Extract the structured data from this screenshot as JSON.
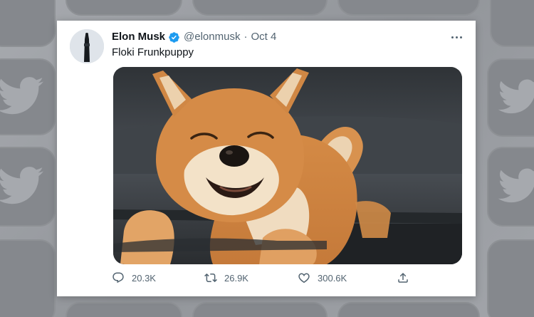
{
  "background": {
    "pattern_icon": "twitter-bird-icon"
  },
  "tweet": {
    "author": {
      "name": "Elon Musk",
      "handle": "@elonmusk",
      "verified_icon": "verified-badge-icon",
      "verified_color": "#1d9bf0"
    },
    "separator": "·",
    "date": "Oct 4",
    "text": "Floki Frunkpuppy",
    "media_description": "shiba-inu-puppy-photo",
    "more_icon": "more-icon",
    "actions": {
      "replies": {
        "icon": "reply-icon",
        "count": "20.3K"
      },
      "retweets": {
        "icon": "retweet-icon",
        "count": "26.9K"
      },
      "likes": {
        "icon": "like-icon",
        "count": "300.6K"
      },
      "share": {
        "icon": "share-icon"
      }
    },
    "colors": {
      "text": "#0f1419",
      "secondary": "#536471",
      "background": "#ffffff"
    }
  }
}
